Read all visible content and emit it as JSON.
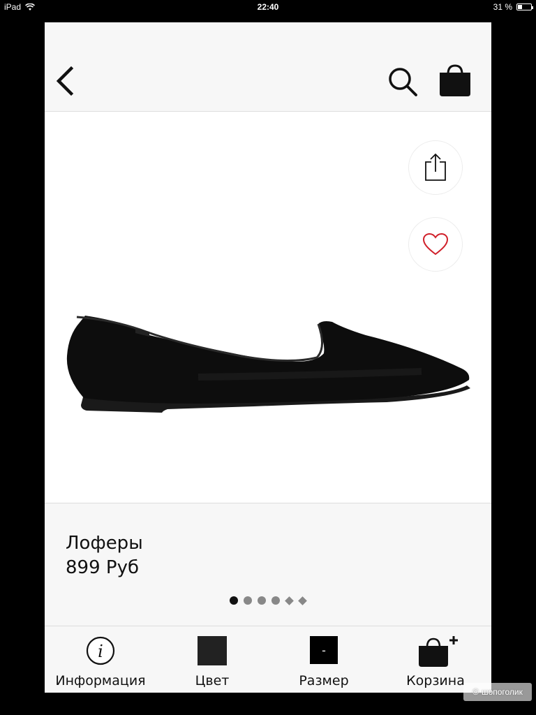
{
  "status_bar": {
    "device": "iPad",
    "time": "22:40",
    "battery_text": "31 %",
    "battery_level": 0.31
  },
  "header": {
    "back_icon": "chevron-left-icon",
    "search_icon": "search-icon",
    "bag_icon": "shopping-bag-icon"
  },
  "image_actions": {
    "share_icon": "share-icon",
    "favorite_icon": "heart-icon"
  },
  "product": {
    "name": "Лоферы",
    "price": "899 Руб"
  },
  "pagination": {
    "total": 6,
    "active_index": 0
  },
  "toolbar": {
    "info_label": "Информация",
    "color_label": "Цвет",
    "size_label": "Размер",
    "size_value": "-",
    "cart_label": "Корзина"
  },
  "colors": {
    "accent_heart": "#d0202a",
    "selected_color": "#222222"
  },
  "watermark": {
    "text": "шопоголик"
  }
}
